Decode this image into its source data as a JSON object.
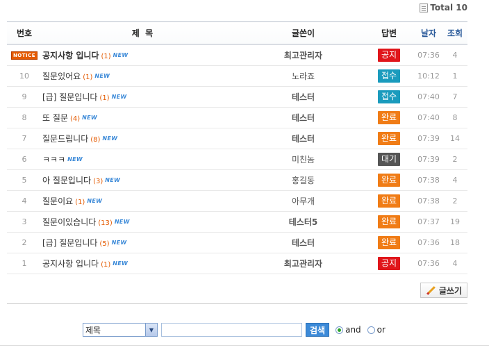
{
  "total_label": "Total 10",
  "columns": {
    "no": "번호",
    "title": "제  목",
    "author": "글쓴이",
    "answer": "답변",
    "date": "날자",
    "views": "조회"
  },
  "new_icon_text": "NEW",
  "notice_badge": "NOTICE",
  "rows": [
    {
      "no": "",
      "notice": true,
      "title": "공지사항 입니다",
      "comments": "(1)",
      "author": "최고관리자",
      "answer": "공지",
      "answer_color": "red",
      "time": "07:36",
      "views": "4"
    },
    {
      "no": "10",
      "title": "질문있어요",
      "comments": "(1)",
      "author": "노라죠",
      "answer": "접수",
      "answer_color": "teal",
      "time": "10:12",
      "views": "1"
    },
    {
      "no": "9",
      "title": "[급] 질문입니다",
      "comments": "(1)",
      "author": "테스터",
      "answer": "접수",
      "answer_color": "teal",
      "time": "07:40",
      "views": "7"
    },
    {
      "no": "8",
      "title": "또 질문",
      "comments": "(4)",
      "author": "테스터",
      "answer": "완료",
      "answer_color": "orange",
      "time": "07:40",
      "views": "8"
    },
    {
      "no": "7",
      "title": "질문드립니다",
      "comments": "(8)",
      "author": "테스터",
      "answer": "완료",
      "answer_color": "orange",
      "time": "07:39",
      "views": "14"
    },
    {
      "no": "6",
      "title": "ㅋㅋㅋ",
      "comments": "",
      "author": "미친놈",
      "answer": "대기",
      "answer_color": "dark",
      "time": "07:39",
      "views": "2"
    },
    {
      "no": "5",
      "title": "아 질문입니다",
      "comments": "(3)",
      "author": "홍길동",
      "answer": "완료",
      "answer_color": "orange",
      "time": "07:38",
      "views": "4"
    },
    {
      "no": "4",
      "title": "질문이요",
      "comments": "(1)",
      "author": "아무개",
      "answer": "완료",
      "answer_color": "orange",
      "time": "07:38",
      "views": "2"
    },
    {
      "no": "3",
      "title": "질문이있습니다",
      "comments": "(13)",
      "author": "테스터5",
      "answer": "완료",
      "answer_color": "orange",
      "time": "07:37",
      "views": "19"
    },
    {
      "no": "2",
      "title": "[급] 질문입니다",
      "comments": "(5)",
      "author": "테스터",
      "answer": "완료",
      "answer_color": "orange",
      "time": "07:36",
      "views": "18"
    },
    {
      "no": "1",
      "title": "공지사항 입니다",
      "comments": "(1)",
      "author": "최고관리자",
      "answer": "공지",
      "answer_color": "red",
      "time": "07:36",
      "views": "4"
    }
  ],
  "bold_authors": [
    "최고관리자",
    "테스터",
    "테스터5"
  ],
  "write_button_label": "글쓰기",
  "search": {
    "select_value": "제목",
    "input_value": "",
    "button_label": "검색",
    "radio_and": "and",
    "radio_or": "or",
    "selected": "and"
  },
  "colors": {
    "red": "#e0161b",
    "teal": "#1a9bbd",
    "orange": "#f07c16",
    "dark": "#555555",
    "accent": "#3c8ad8"
  }
}
